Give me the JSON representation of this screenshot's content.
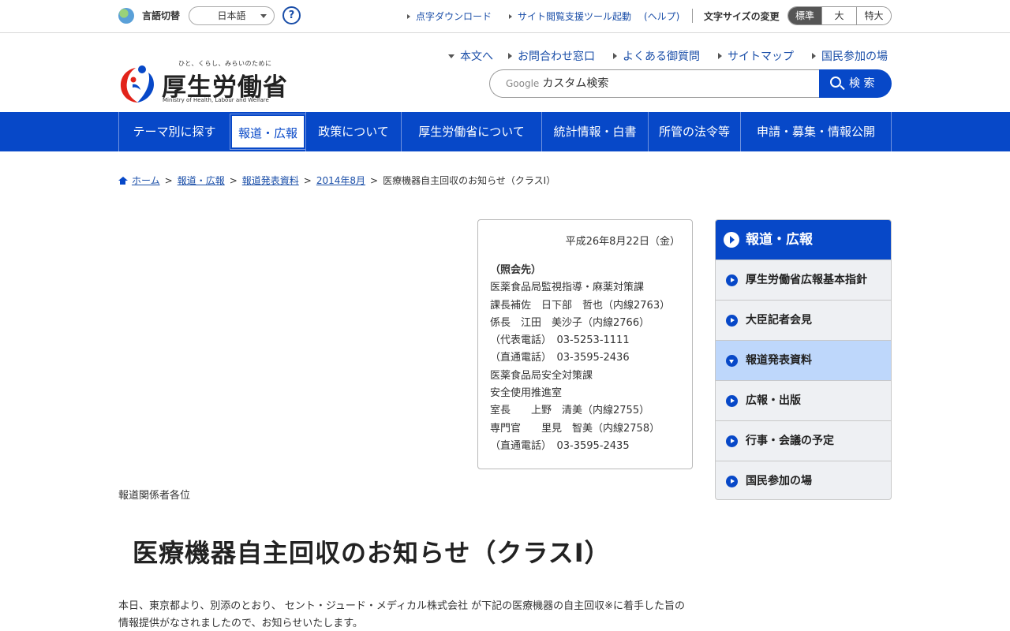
{
  "utility": {
    "lang_label": "言語切替",
    "lang_value": "日本語",
    "help_symbol": "?",
    "links": [
      "点字ダウンロード",
      "サイト閲覧支援ツール起動",
      "(ヘルプ)"
    ],
    "fontsize_label": "文字サイズの変更",
    "fontsize_options": [
      "標準",
      "大",
      "特大"
    ]
  },
  "logo": {
    "tagline": "ひと、くらし、みらいのために",
    "title": "厚生労働省",
    "english": "Ministry of Health, Labour and Welfare"
  },
  "header": {
    "links": [
      "本文へ",
      "お問合わせ窓口",
      "よくある御質問",
      "サイトマップ",
      "国民参加の場"
    ],
    "search_brand": "Google",
    "search_placeholder": "カスタム検索",
    "search_button": "検 索"
  },
  "gnav": [
    "テーマ別に探す",
    "報道・広報",
    "政策について",
    "厚生労働省について",
    "統計情報・白書",
    "所管の法令等",
    "申請・募集・情報公開"
  ],
  "breadcrumb": {
    "items": [
      "ホーム",
      "報道・広報",
      "報道発表資料",
      "2014年8月"
    ],
    "current": "医療機器自主回収のお知らせ（クラスⅠ）",
    "separator": ">"
  },
  "contact": {
    "date": "平成26年8月22日（金）",
    "heading": "（照会先）",
    "lines": [
      "医薬食品局監視指導・麻薬対策課",
      "課長補佐　日下部　哲也（内線2763）",
      "係長　江田　美沙子（内線2766）",
      "（代表電話）　03-5253-1111",
      "（直通電話）　03-3595-2436",
      "医薬食品局安全対策課",
      "安全使用推進室",
      "室長　　上野　清美（内線2755）",
      "専門官　　里見　智美（内線2758）",
      "（直通電話）　03-3595-2435"
    ]
  },
  "recipient": "報道関係者各位",
  "title": "医療機器自主回収のお知らせ（クラスⅠ）",
  "body": "本日、東京都より、別添のとおり、 セント・ジュード・メディカル株式会社 が下記の医療機器の自主回収※に着手した旨の情報提供がなされましたので、お知らせいたします。",
  "side": {
    "heading": "報道・広報",
    "items": [
      "厚生労働省広報基本指針",
      "大臣記者会見",
      "報道発表資料",
      "広報・出版",
      "行事・会議の予定",
      "国民参加の場"
    ]
  },
  "colors": {
    "brand_blue": "#0748c8",
    "active_side": "#bed7fb"
  }
}
